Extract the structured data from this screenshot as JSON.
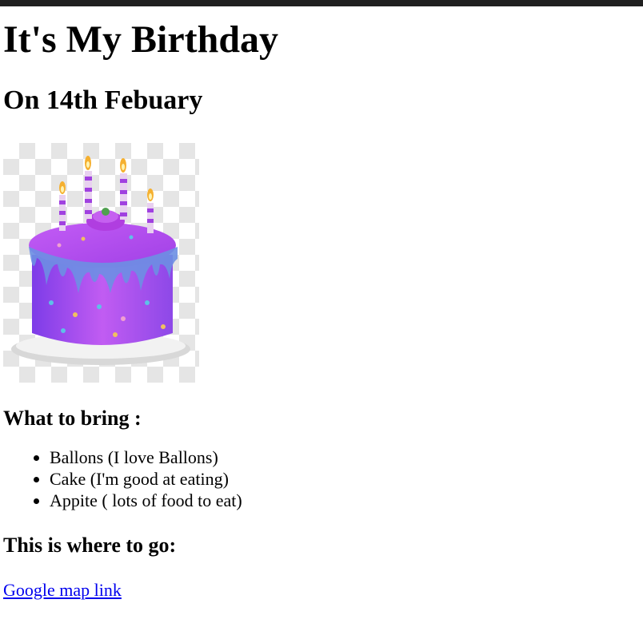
{
  "header": {
    "title": "It's My Birthday",
    "subtitle": "On 14th Febuary"
  },
  "image": {
    "alt": "birthday cake",
    "icon": "birthday-cake-icon",
    "colors": {
      "frosting": "#b14cf0",
      "cake_body": "#9b5cf5",
      "drip": "#6a8ee0",
      "plate": "#e8e8e8"
    }
  },
  "bring": {
    "heading": "What to bring :",
    "items": [
      "Ballons (I love Ballons)",
      "Cake (I'm good at eating)",
      "Appite ( lots of food to eat)"
    ]
  },
  "location": {
    "heading": "This is where to go:",
    "link_text": "Google map link"
  }
}
